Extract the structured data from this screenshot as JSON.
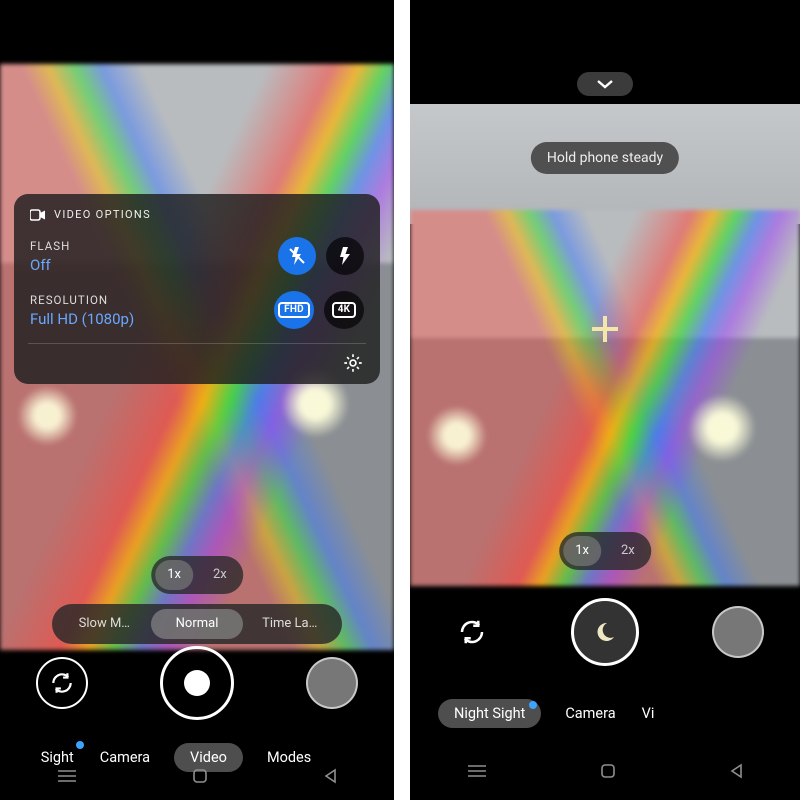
{
  "left": {
    "panel": {
      "title": "VIDEO OPTIONS",
      "flash_label": "FLASH",
      "flash_value": "Off",
      "resolution_label": "RESOLUTION",
      "resolution_value": "Full HD (1080p)",
      "fhd_badge": "FHD",
      "fourk_badge": "4K"
    },
    "zoom": {
      "x1": "1x",
      "x2": "2x",
      "selected": "1x"
    },
    "speed": {
      "slow": "Slow M…",
      "normal": "Normal",
      "timelapse": "Time La…",
      "selected": "Normal"
    },
    "modes": {
      "sight": "Sight",
      "camera": "Camera",
      "video": "Video",
      "modes_btn": "Modes",
      "selected": "Video"
    }
  },
  "right": {
    "toast": "Hold phone steady",
    "zoom": {
      "x1": "1x",
      "x2": "2x",
      "selected": "1x"
    },
    "modes": {
      "night": "Night Sight",
      "camera": "Camera",
      "video_partial": "Vi",
      "selected": "Night Sight"
    }
  }
}
